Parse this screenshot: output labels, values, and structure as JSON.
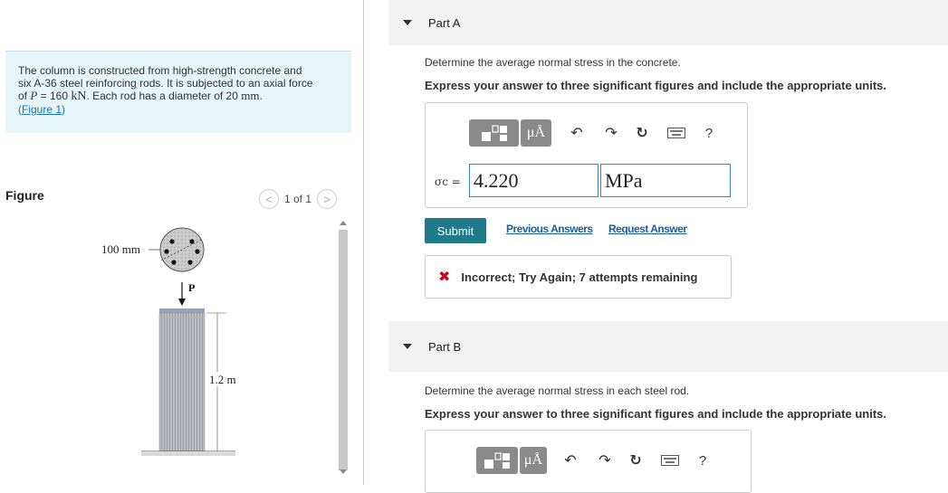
{
  "problem": {
    "text_1": "The column is constructed from high-strength concrete and",
    "text_2": "six A-36 steel reinforcing rods. It is subjected to an axial force",
    "text_3_a": "of ",
    "text_3_p": "P",
    "text_3_b": " = 160 ",
    "text_3_unit": "kN",
    "text_3_c": ". Each rod has a diameter of 20 ",
    "text_3_mm": "mm",
    "text_3_d": ".",
    "figure_link": "Figure 1",
    "paren_open": "(",
    "paren_close": ")"
  },
  "figure": {
    "title": "Figure",
    "pager": "1 of 1",
    "prev_glyph": "<",
    "next_glyph": ">",
    "dim_diameter": "100 mm",
    "load_label": "P",
    "dim_height": "1.2 m"
  },
  "part_a": {
    "title": "Part A",
    "question": "Determine the average normal stress in the concrete.",
    "instruction": "Express your answer to three significant figures and include the appropriate units.",
    "symbol_label": "σc =",
    "value": "4.220",
    "unit": "MPa",
    "submit_label": "Submit",
    "previous_answers": "Previous Answers",
    "request_answer": "Request Answer",
    "feedback": "Incorrect; Try Again; 7 attempts remaining",
    "toolbar": {
      "units_button": "μÅ",
      "help": "?"
    }
  },
  "part_b": {
    "title": "Part B",
    "question": "Determine the average normal stress in each steel rod.",
    "instruction": "Express your answer to three significant figures and include the appropriate units.",
    "toolbar": {
      "units_button": "μÅ",
      "help": "?"
    }
  },
  "colors": {
    "accent": "#1f7a8c",
    "link": "#1a5ea8",
    "error": "#d0021b",
    "problem_bg": "#e6f5f7"
  }
}
